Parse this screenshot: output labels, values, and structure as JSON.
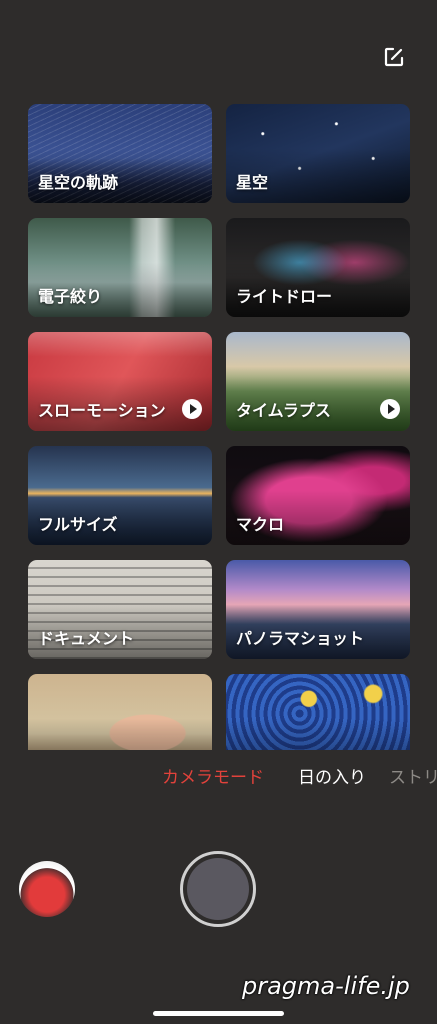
{
  "header": {
    "edit_icon": "edit-icon"
  },
  "tiles": [
    {
      "label": "星空の軌跡",
      "bg": "bg-trails",
      "video": false
    },
    {
      "label": "星空",
      "bg": "bg-stars",
      "video": false
    },
    {
      "label": "電子絞り",
      "bg": "bg-water",
      "video": false
    },
    {
      "label": "ライトドロー",
      "bg": "bg-love",
      "video": false
    },
    {
      "label": "スローモーション",
      "bg": "bg-slowmo",
      "video": true
    },
    {
      "label": "タイムラプス",
      "bg": "bg-lapse",
      "video": true
    },
    {
      "label": "フルサイズ",
      "bg": "bg-full",
      "video": false
    },
    {
      "label": "マクロ",
      "bg": "bg-macro",
      "video": false
    },
    {
      "label": "ドキュメント",
      "bg": "bg-doc",
      "video": false
    },
    {
      "label": "パノラマショット",
      "bg": "bg-pano",
      "video": false
    },
    {
      "label": "",
      "bg": "bg-portrait",
      "video": false
    },
    {
      "label": "",
      "bg": "bg-night",
      "video": false
    }
  ],
  "modes": {
    "active": "カメラモード",
    "next": "日の入り",
    "after": "ストリ"
  },
  "colors": {
    "accent": "#e2423b",
    "background": "#2e2c2b"
  },
  "watermark": "pragma-life.jp"
}
